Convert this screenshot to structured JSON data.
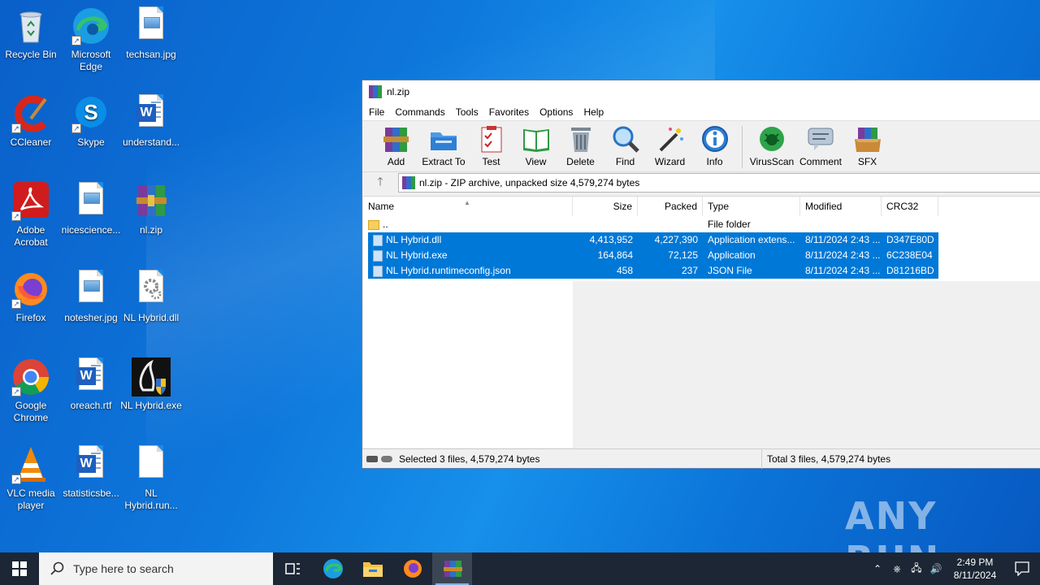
{
  "desktop": {
    "icons": [
      {
        "label": "Recycle Bin",
        "icon": "recycle-bin-icon"
      },
      {
        "label": "Microsoft Edge",
        "icon": "edge-icon"
      },
      {
        "label": "techsan.jpg",
        "icon": "image-file-icon"
      },
      {
        "label": "CCleaner",
        "icon": "ccleaner-icon"
      },
      {
        "label": "Skype",
        "icon": "skype-icon"
      },
      {
        "label": "understand...",
        "icon": "word-doc-icon"
      },
      {
        "label": "Adobe Acrobat",
        "icon": "acrobat-icon"
      },
      {
        "label": "nicescience...",
        "icon": "image-file-icon"
      },
      {
        "label": "nl.zip",
        "icon": "winrar-archive-icon"
      },
      {
        "label": "Firefox",
        "icon": "firefox-icon"
      },
      {
        "label": "notesher.jpg",
        "icon": "image-file-icon"
      },
      {
        "label": "NL Hybrid.dll",
        "icon": "dll-gear-icon"
      },
      {
        "label": "Google Chrome",
        "icon": "chrome-icon"
      },
      {
        "label": "oreach.rtf",
        "icon": "word-doc-icon"
      },
      {
        "label": "NL Hybrid.exe",
        "icon": "exe-shield-icon"
      },
      {
        "label": "VLC media player",
        "icon": "vlc-icon"
      },
      {
        "label": "statisticsbe...",
        "icon": "word-doc-icon"
      },
      {
        "label": "NL Hybrid.run...",
        "icon": "blank-file-icon"
      }
    ]
  },
  "window": {
    "title": "nl.zip",
    "menu": [
      "File",
      "Commands",
      "Tools",
      "Favorites",
      "Options",
      "Help"
    ],
    "toolbar": [
      "Add",
      "Extract To",
      "Test",
      "View",
      "Delete",
      "Find",
      "Wizard",
      "Info",
      "VirusScan",
      "Comment",
      "SFX"
    ],
    "address": "nl.zip - ZIP archive, unpacked size 4,579,274 bytes",
    "columns": [
      "Name",
      "Size",
      "Packed",
      "Type",
      "Modified",
      "CRC32"
    ],
    "rows": [
      {
        "name": "..",
        "size": "",
        "packed": "",
        "type": "File folder",
        "modified": "",
        "crc": "",
        "selected": false,
        "folder": true
      },
      {
        "name": "NL Hybrid.dll",
        "size": "4,413,952",
        "packed": "4,227,390",
        "type": "Application extens...",
        "modified": "8/11/2024 2:43 ...",
        "crc": "D347E80D",
        "selected": true,
        "folder": false
      },
      {
        "name": "NL Hybrid.exe",
        "size": "164,864",
        "packed": "72,125",
        "type": "Application",
        "modified": "8/11/2024 2:43 ...",
        "crc": "6C238E04",
        "selected": true,
        "folder": false
      },
      {
        "name": "NL Hybrid.runtimeconfig.json",
        "size": "458",
        "packed": "237",
        "type": "JSON File",
        "modified": "8/11/2024 2:43 ...",
        "crc": "D81216BD",
        "selected": true,
        "folder": false
      }
    ],
    "status_left": "Selected 3 files, 4,579,274 bytes",
    "status_right": "Total 3 files, 4,579,274 bytes"
  },
  "watermark": "ANY RUN",
  "taskbar": {
    "search_placeholder": "Type here to search",
    "time": "2:49 PM",
    "date": "8/11/2024"
  }
}
